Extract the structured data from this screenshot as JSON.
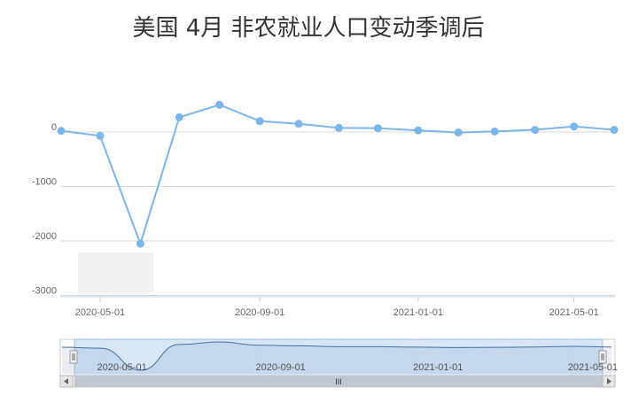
{
  "chart_data": {
    "type": "line",
    "title": "美国 4月 非农就业人口变动季调后",
    "x": [
      "2020-04-01",
      "2020-05-01",
      "2020-06-01",
      "2020-07-01",
      "2020-08-01",
      "2020-09-01",
      "2020-10-01",
      "2020-11-01",
      "2020-12-01",
      "2021-01-01",
      "2021-02-01",
      "2021-03-01",
      "2021-04-01",
      "2021-05-01",
      "2021-06-01"
    ],
    "series": [
      {
        "values": [
          20,
          -70,
          -2050,
          270,
          500,
          200,
          150,
          75,
          70,
          30,
          -10,
          10,
          40,
          100,
          40
        ]
      }
    ],
    "y_ticks": [
      0,
      -1000,
      -2000,
      -3000
    ],
    "y_tick_labels": [
      "0",
      "-1000",
      "-2000",
      "-3000"
    ],
    "x_tick_labels": [
      "2020-05-01",
      "2020-09-01",
      "2021-01-01",
      "2021-05-01"
    ],
    "navigator_labels": [
      "2020-05-01",
      "2020-09-01",
      "2021-01-01",
      "2021-05-01"
    ],
    "scrollbar_grip": "III",
    "ylim": [
      -3000,
      500
    ],
    "grid": true,
    "legend": "none",
    "colors": {
      "line": "#7cb5ec",
      "grid": "#d8d8d8",
      "navigator_fill": "#c9dcf2",
      "navigator_line": "#4572a7"
    }
  }
}
